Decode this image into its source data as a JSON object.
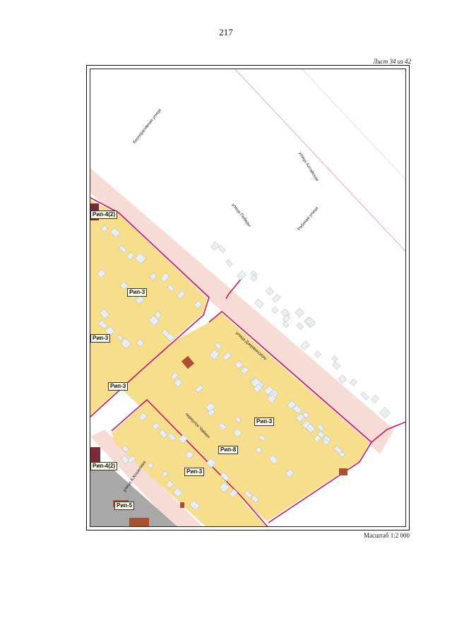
{
  "page_number": "217",
  "sheet_label": "Лист 34 из 42",
  "scale_label": "Масштаб 1:2 000",
  "colors": {
    "residential_zone": "#f6de8c",
    "road_band": "#f6d6cf",
    "boundary": "#c2186b",
    "building": "#e9eef2",
    "special_zone": "#a8a8a8",
    "dark_zone": "#7a2b3a",
    "brick_building": "#a8502f",
    "railroad_line": "#e08fd6"
  },
  "streets": {
    "kooperativnaya": "Кооперативная улица",
    "altaiskaya": "улица Алтайская",
    "pobedy": "улица Победы",
    "rabochaya": "Рабочая улица",
    "dzerzhinskogo": "улица Дзержинского",
    "chaikin": "переулок Чайкин",
    "a_kosheleva": "улица А.Кошелева"
  },
  "zones": {
    "rip4_top": "Рип-4(2)",
    "rip3_a": "Рип-3",
    "rip3_b": "Рип-3",
    "rip3_c": "Рип-3",
    "rip3_d": "Рип-3",
    "rip3_e": "Рип-3",
    "rip8": "Рип-8",
    "rip4_bottom": "Рип-4(2)",
    "rip5": "Рип-5"
  }
}
